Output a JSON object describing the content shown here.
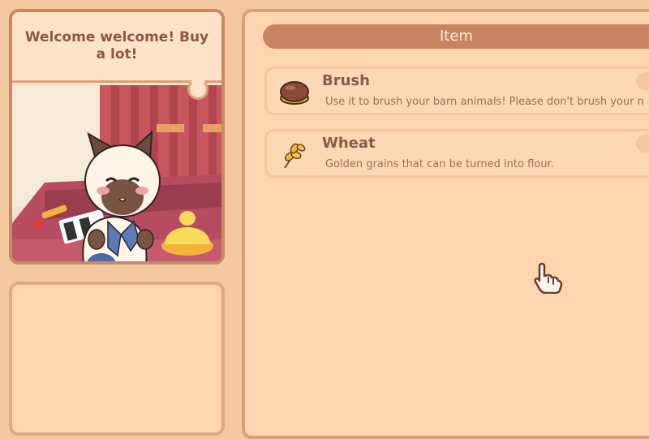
{
  "shopkeeper": {
    "speech": "Welcome welcome! Buy a lot!"
  },
  "item_panel": {
    "header": "Item",
    "items": [
      {
        "name": "Brush",
        "description": "Use it to brush your barn animals! Please don't brush your n",
        "icon": "brush-icon"
      },
      {
        "name": "Wheat",
        "description": "Golden grains that can be turned into flour.",
        "icon": "wheat-icon"
      }
    ]
  },
  "cursor": {
    "icon": "pointing-hand-cursor-icon"
  },
  "colors": {
    "background": "#f4c9a0",
    "panel": "#fdd5b0",
    "header": "#c88462",
    "text": "#8a5a48"
  }
}
